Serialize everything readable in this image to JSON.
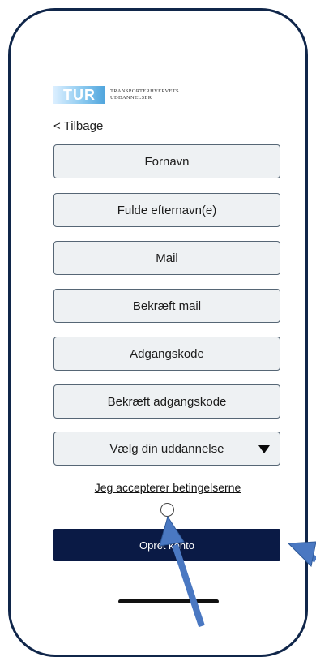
{
  "logo": {
    "mark": "TUR",
    "line1": "TRANSPORTERHVERVETS",
    "line2": "UDDANNELSER"
  },
  "nav": {
    "back_label": "< Tilbage"
  },
  "form": {
    "first_name": "Fornavn",
    "last_name": "Fulde efternavn(e)",
    "mail": "Mail",
    "confirm_mail": "Bekræft mail",
    "password": "Adgangskode",
    "confirm_password": "Bekræft adgangskode",
    "education_select": "Vælg din uddannelse",
    "terms_link": "Jeg accepterer betingelserne",
    "submit_label": "Opret konto"
  },
  "colors": {
    "frame": "#10264a",
    "field_bg": "#eef1f3",
    "submit_bg": "#0a1a45",
    "annotation_arrow": "#4a78c2"
  }
}
